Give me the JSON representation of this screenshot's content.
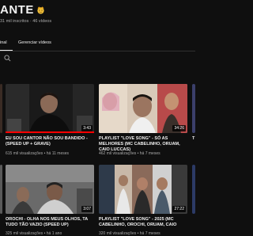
{
  "channel": {
    "title": "ANTE",
    "subtitle": "31 mil inscritos · 46 vídeos"
  },
  "tabs": [
    {
      "label": "inal"
    },
    {
      "label": "Gerenciar vídeos"
    }
  ],
  "videos": [
    {
      "title": "",
      "meta": ""
    },
    {
      "title": "EU SOU CANTOR NÃO SOU BANDIDO - (SPEED UP + GRAVE)",
      "meta": "615 mil visualizações • há 11 meses",
      "duration": "3:43"
    },
    {
      "title": "PLAYLIST \"LOVE SONG\" - SÓ AS MELHORES (MC CABELINHO, ORUAM, CAIO LUCCAS)",
      "meta": "462 mil visualizações • há 7 meses",
      "duration": "34:26"
    },
    {
      "title": "T",
      "meta": ""
    },
    {
      "title": "",
      "meta": ""
    },
    {
      "title": "OROCHI - OLHA NOS MEUS OLHOS, TA TUDO TÃO VAZIO (SPEED UP)",
      "meta": "325 mil visualizações • há 1 ano",
      "duration": "3:07"
    },
    {
      "title": "PLAYLIST \"LOVE SONG\" - 2025 (MC CABELINHO, OROCHI, ORUAM, CAIO",
      "meta": "320 mil visualizações • há 7 meses",
      "duration": "27:22"
    },
    {
      "title": "",
      "meta": ""
    }
  ]
}
